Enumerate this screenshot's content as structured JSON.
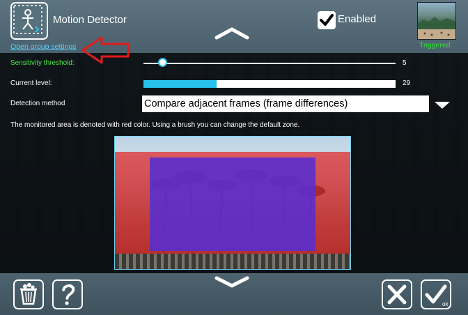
{
  "header": {
    "title": "Motion Detector",
    "app_icon": "motion-detector-icon",
    "group_link": "Open group settings",
    "enabled_label": "Enabled",
    "enabled": true,
    "thumbnail_status": "Triggered",
    "scroll_up_icon": "chevron-up-icon"
  },
  "settings": {
    "sensitivity": {
      "label": "Sensitivity threshold:",
      "value": "5",
      "fraction": 0.05
    },
    "current_level": {
      "label": "Current level:",
      "value": "29",
      "fraction": 0.29
    },
    "detection": {
      "label": "Detection method",
      "selected": "Compare adjacent frames (frame differences)",
      "arrow_icon": "dropdown-arrow-icon"
    },
    "info_text": "The monitored area is denoted with red color. Using a brush you can change the default zone."
  },
  "toolbar": {
    "trash_icon": "trash-icon",
    "help_icon": "help-icon",
    "cancel_icon": "close-icon",
    "ok_icon": "check-icon",
    "ok_label": "ok",
    "scroll_down_icon": "chevron-down-icon"
  },
  "colors": {
    "accent": "#29c2ee",
    "sensitivity_label": "#49e849",
    "triggered": "#33e033",
    "link": "#5bd1ff",
    "zone_red": "#e22828",
    "zone_blue": "#562dd2"
  }
}
